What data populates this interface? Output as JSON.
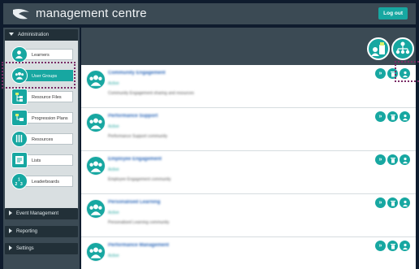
{
  "app": {
    "title": "management centre",
    "logout_label": "Log out"
  },
  "sidebar": {
    "sections": [
      {
        "label": "Administration",
        "expanded": true
      },
      {
        "label": "Event Management",
        "expanded": false
      },
      {
        "label": "Reporting",
        "expanded": false
      },
      {
        "label": "Settings",
        "expanded": false
      }
    ],
    "items": [
      {
        "label": "Learners",
        "icon": "user-icon"
      },
      {
        "label": "User Groups",
        "icon": "group-icon",
        "active": true
      },
      {
        "label": "Resource Files",
        "icon": "file-tree-icon"
      },
      {
        "label": "Progression Plans",
        "icon": "plan-icon"
      },
      {
        "label": "Resources",
        "icon": "tools-icon"
      },
      {
        "label": "Lists",
        "icon": "list-icon"
      },
      {
        "label": "Leaderboards",
        "icon": "numbers-icon"
      }
    ]
  },
  "header_actions": [
    {
      "name": "add-group-icon"
    },
    {
      "name": "hierarchy-icon"
    }
  ],
  "groups": [
    {
      "title": "Community Engagement",
      "status": "Active",
      "description": "Community Engagement sharing and resources"
    },
    {
      "title": "Performance Support",
      "status": "Active",
      "description": "Performance Support community"
    },
    {
      "title": "Employee Engagement",
      "status": "Active",
      "description": "Employee Engagement community"
    },
    {
      "title": "Personalised Learning",
      "status": "Active",
      "description": "Personalised Learning community"
    },
    {
      "title": "Performance Management",
      "status": "Active",
      "description": ""
    }
  ],
  "colors": {
    "accent": "#17a7a1",
    "header": "#3b4a54",
    "link": "#2a66b8",
    "highlight": "#7a2c66"
  }
}
